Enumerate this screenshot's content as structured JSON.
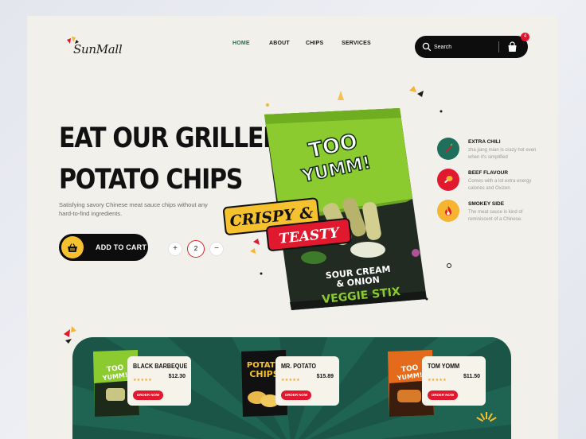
{
  "brand": {
    "name": "SunMall"
  },
  "nav": {
    "items": [
      "HOME",
      "ABOUT",
      "CHIPS",
      "SERVICES"
    ],
    "active": "HOME"
  },
  "search": {
    "placeholder": "Search"
  },
  "cart": {
    "count": "4"
  },
  "hero": {
    "title_line1": "EAT OUR GRILLED",
    "title_line2": "POTATO CHIPS",
    "subtitle": "Satisfying savory Chinese meat sauce chips without any hard-to-find ingredients.",
    "add_to_cart_label": "ADD TO CART",
    "quantity": "2",
    "minus": "−",
    "plus": "+"
  },
  "package": {
    "brand_line1": "TOO",
    "brand_line2": "YUMM!",
    "tag1": "CRISPY &",
    "tag2": "TEASTY",
    "flavor_line1": "SOUR CREAM",
    "flavor_line2": "& ONION",
    "product_line": "VEGGIE STIX"
  },
  "features": [
    {
      "title": "EXTRA CHILI",
      "desc": "zha jiang mian is crazy hot even when it's simplified",
      "color": "#1e6f5c",
      "icon": "chili-icon"
    },
    {
      "title": "BEEF FLAVOUR",
      "desc": "Comes with a lot extra energy calories and Oxizen",
      "color": "#e1192e",
      "icon": "drumstick-icon"
    },
    {
      "title": "SMOKEY SIDE",
      "desc": "The meat sauce is kind of reminiscent of a Chinese.",
      "color": "#f6b430",
      "icon": "flame-icon"
    }
  ],
  "products": [
    {
      "name": "BLACK BARBEQUE",
      "price": "$12.30",
      "stars": "★★★★★",
      "order_label": "ORDER NOW",
      "bag_color": "#3c8d1e"
    },
    {
      "name": "MR. POTATO",
      "price": "$15.89",
      "stars": "★★★★★",
      "order_label": "ORDER NOW",
      "bag_color": "#111111"
    },
    {
      "name": "TOM YOMM",
      "price": "$11.50",
      "stars": "★★★★★",
      "order_label": "ORDER NOW",
      "bag_color": "#e46b1b"
    }
  ],
  "colors": {
    "accent_green": "#1e6f5c",
    "accent_red": "#e1192e",
    "accent_yellow": "#f6c12f",
    "panel_green": "#1a5547"
  }
}
